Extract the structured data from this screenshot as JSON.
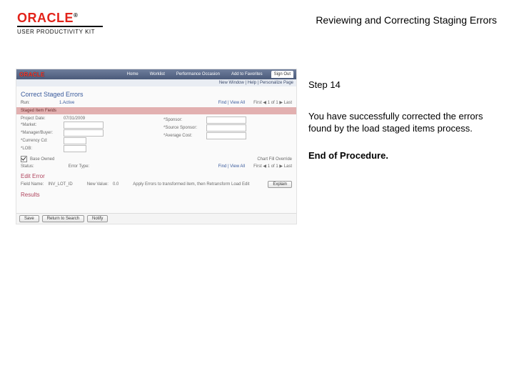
{
  "header": {
    "brand_name": "ORACLE",
    "brand_sub": "USER PRODUCTIVITY KIT",
    "doc_title": "Reviewing and Correcting Staging Errors"
  },
  "step": {
    "label": "Step 14",
    "description": "You have successfully corrected the errors found by the load staged items process.",
    "end": "End of Procedure."
  },
  "screenshot": {
    "brandbar": "ORACLE",
    "nav_tabs": [
      "Home",
      "Worklist",
      "Performance Occasion",
      "Add to Favorites",
      "Sign Out"
    ],
    "subnav": "New Window | Help | Personalize Page",
    "page_title": "Correct Staged Errors",
    "run_label": "Run:",
    "run_link": "1.Active",
    "view_all_label": "Find | View All",
    "pager": "First ◀ 1 of 1 ▶ Last",
    "staged_section": "Staged Item Fields",
    "left_fields": [
      {
        "label": "Project Date:",
        "value": "07/31/2009"
      },
      {
        "label": "*Market:",
        "value": ""
      },
      {
        "label": "*Manager/Buyer:",
        "value": ""
      },
      {
        "label": "*Currency Cd:",
        "value": ""
      },
      {
        "label": "*LOB:",
        "value": ""
      }
    ],
    "right_fields": [
      {
        "label": "*Sponsor:",
        "value": ""
      },
      {
        "label": "*Source Sponsor:",
        "value": ""
      },
      {
        "label": "*Average Cost:",
        "value": ""
      }
    ],
    "base_owned_label": "Base Owned",
    "base_owned_checked": true,
    "chart_fill_label": "Chart Fill Override",
    "status_label": "Status:",
    "error_type_label": "Error Type:",
    "edit_section": "Edit Error",
    "field_name_label": "Field Name:",
    "field_name_value": "INV_LOT_ID",
    "new_value_label": "New Value:",
    "new_value_value": "0.0",
    "apply_label": "Apply Errors to transformed item, then Retransform Load Edit",
    "explain_btn": "Explain",
    "results_label": "Results",
    "btn_save": "Save",
    "btn_return": "Return to Search",
    "btn_notify": "Notify"
  }
}
